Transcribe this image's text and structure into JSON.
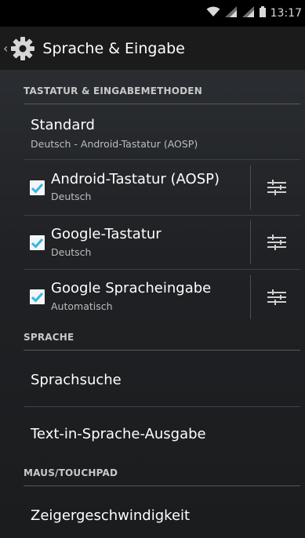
{
  "status_bar": {
    "icons": [
      "wifi-icon",
      "signal-icon",
      "signal-icon",
      "battery-icon"
    ],
    "time": "13:17"
  },
  "action_bar": {
    "icon": "gear-icon",
    "title": "Sprache & Eingabe"
  },
  "sections": {
    "keyboard": {
      "header": "TASTATUR & EINGABEMETHODEN",
      "default": {
        "title": "Standard",
        "subtitle": "Deutsch - Android-Tastatur (AOSP)"
      },
      "methods": [
        {
          "title": "Android-Tastatur (AOSP)",
          "subtitle": "Deutsch",
          "checked": true
        },
        {
          "title": "Google-Tastatur",
          "subtitle": "Deutsch",
          "checked": true
        },
        {
          "title": "Google Spracheingabe",
          "subtitle": "Automatisch",
          "checked": true
        }
      ]
    },
    "speech": {
      "header": "SPRACHE",
      "items": [
        "Sprachsuche",
        "Text-in-Sprache-Ausgabe"
      ]
    },
    "mouse": {
      "header": "MAUS/TOUCHPAD",
      "items": [
        "Zeigergeschwindigkeit"
      ]
    }
  },
  "colors": {
    "accent_check": "#33b5e5",
    "header_text": "#c8c8c8",
    "background": "#1f2124"
  }
}
